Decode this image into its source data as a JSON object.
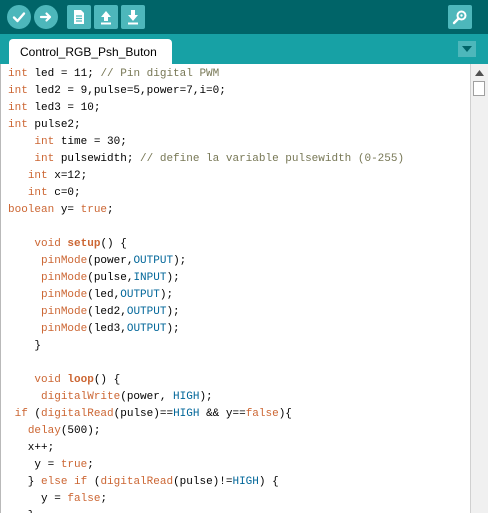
{
  "toolbar": {
    "buttons": [
      {
        "name": "verify",
        "icon": "checkmark-icon"
      },
      {
        "name": "upload",
        "icon": "arrow-right-icon"
      },
      {
        "name": "new",
        "icon": "document-icon"
      },
      {
        "name": "open",
        "icon": "arrow-up-icon"
      },
      {
        "name": "save",
        "icon": "arrow-down-icon"
      },
      {
        "name": "serial-monitor",
        "icon": "magnifier-icon"
      }
    ]
  },
  "tabs": {
    "active": "Control_RGB_Psh_Buton",
    "menu_icon": "triangle-down-icon"
  },
  "colors": {
    "toolbar_bg": "#006468",
    "tabbar_bg": "#17a1a5",
    "button_bg": "#4db7bb",
    "keyword": "#cc6633",
    "constant": "#006699",
    "comment": "#777755"
  },
  "code": {
    "lines": [
      [
        {
          "t": "int",
          "c": "kw-type"
        },
        {
          "t": " led = 11; "
        },
        {
          "t": "// Pin digital PWM",
          "c": "comment"
        }
      ],
      [
        {
          "t": "int",
          "c": "kw-type"
        },
        {
          "t": " led2 = 9,pulse=5,power=7,i=0;"
        }
      ],
      [
        {
          "t": "int",
          "c": "kw-type"
        },
        {
          "t": " led3 = 10;"
        }
      ],
      [
        {
          "t": "int",
          "c": "kw-type"
        },
        {
          "t": " pulse2;"
        }
      ],
      [
        {
          "t": "    "
        },
        {
          "t": "int",
          "c": "kw-type"
        },
        {
          "t": " time = 30;"
        }
      ],
      [
        {
          "t": "    "
        },
        {
          "t": "int",
          "c": "kw-type"
        },
        {
          "t": " pulsewidth; "
        },
        {
          "t": "// define la variable pulsewidth (0-255)",
          "c": "comment"
        }
      ],
      [
        {
          "t": "   "
        },
        {
          "t": "int",
          "c": "kw-type"
        },
        {
          "t": " x=12;"
        }
      ],
      [
        {
          "t": "   "
        },
        {
          "t": "int",
          "c": "kw-type"
        },
        {
          "t": " c=0;"
        }
      ],
      [
        {
          "t": "boolean",
          "c": "kw-type"
        },
        {
          "t": " y= "
        },
        {
          "t": "true",
          "c": "kw-type"
        },
        {
          "t": ";"
        }
      ],
      [],
      [
        {
          "t": "    "
        },
        {
          "t": "void",
          "c": "kw-type"
        },
        {
          "t": " "
        },
        {
          "t": "setup",
          "c": "kw-func-bold"
        },
        {
          "t": "() {"
        }
      ],
      [
        {
          "t": "     "
        },
        {
          "t": "pinMode",
          "c": "kw-func"
        },
        {
          "t": "(power,"
        },
        {
          "t": "OUTPUT",
          "c": "kw-const"
        },
        {
          "t": ");"
        }
      ],
      [
        {
          "t": "     "
        },
        {
          "t": "pinMode",
          "c": "kw-func"
        },
        {
          "t": "(pulse,"
        },
        {
          "t": "INPUT",
          "c": "kw-const"
        },
        {
          "t": ");"
        }
      ],
      [
        {
          "t": "     "
        },
        {
          "t": "pinMode",
          "c": "kw-func"
        },
        {
          "t": "(led,"
        },
        {
          "t": "OUTPUT",
          "c": "kw-const"
        },
        {
          "t": ");"
        }
      ],
      [
        {
          "t": "     "
        },
        {
          "t": "pinMode",
          "c": "kw-func"
        },
        {
          "t": "(led2,"
        },
        {
          "t": "OUTPUT",
          "c": "kw-const"
        },
        {
          "t": ");"
        }
      ],
      [
        {
          "t": "     "
        },
        {
          "t": "pinMode",
          "c": "kw-func"
        },
        {
          "t": "(led3,"
        },
        {
          "t": "OUTPUT",
          "c": "kw-const"
        },
        {
          "t": ");"
        }
      ],
      [
        {
          "t": "    }"
        }
      ],
      [],
      [
        {
          "t": "    "
        },
        {
          "t": "void",
          "c": "kw-type"
        },
        {
          "t": " "
        },
        {
          "t": "loop",
          "c": "kw-func-bold"
        },
        {
          "t": "() {"
        }
      ],
      [
        {
          "t": "     "
        },
        {
          "t": "digitalWrite",
          "c": "kw-func"
        },
        {
          "t": "(power, "
        },
        {
          "t": "HIGH",
          "c": "kw-const"
        },
        {
          "t": ");"
        }
      ],
      [
        {
          "t": " "
        },
        {
          "t": "if",
          "c": "kw-type"
        },
        {
          "t": " ("
        },
        {
          "t": "digitalRead",
          "c": "kw-func"
        },
        {
          "t": "(pulse)=="
        },
        {
          "t": "HIGH",
          "c": "kw-const"
        },
        {
          "t": " && y=="
        },
        {
          "t": "false",
          "c": "kw-type"
        },
        {
          "t": "){"
        }
      ],
      [
        {
          "t": "   "
        },
        {
          "t": "delay",
          "c": "kw-func"
        },
        {
          "t": "(500);"
        }
      ],
      [
        {
          "t": "   x++;"
        }
      ],
      [
        {
          "t": "    y = "
        },
        {
          "t": "true",
          "c": "kw-type"
        },
        {
          "t": ";"
        }
      ],
      [
        {
          "t": "   } "
        },
        {
          "t": "else",
          "c": "kw-type"
        },
        {
          "t": " "
        },
        {
          "t": "if",
          "c": "kw-type"
        },
        {
          "t": " ("
        },
        {
          "t": "digitalRead",
          "c": "kw-func"
        },
        {
          "t": "(pulse)!="
        },
        {
          "t": "HIGH",
          "c": "kw-const"
        },
        {
          "t": ") {"
        }
      ],
      [
        {
          "t": "     y = "
        },
        {
          "t": "false",
          "c": "kw-type"
        },
        {
          "t": ";"
        }
      ],
      [
        {
          "t": "   }"
        }
      ]
    ]
  }
}
